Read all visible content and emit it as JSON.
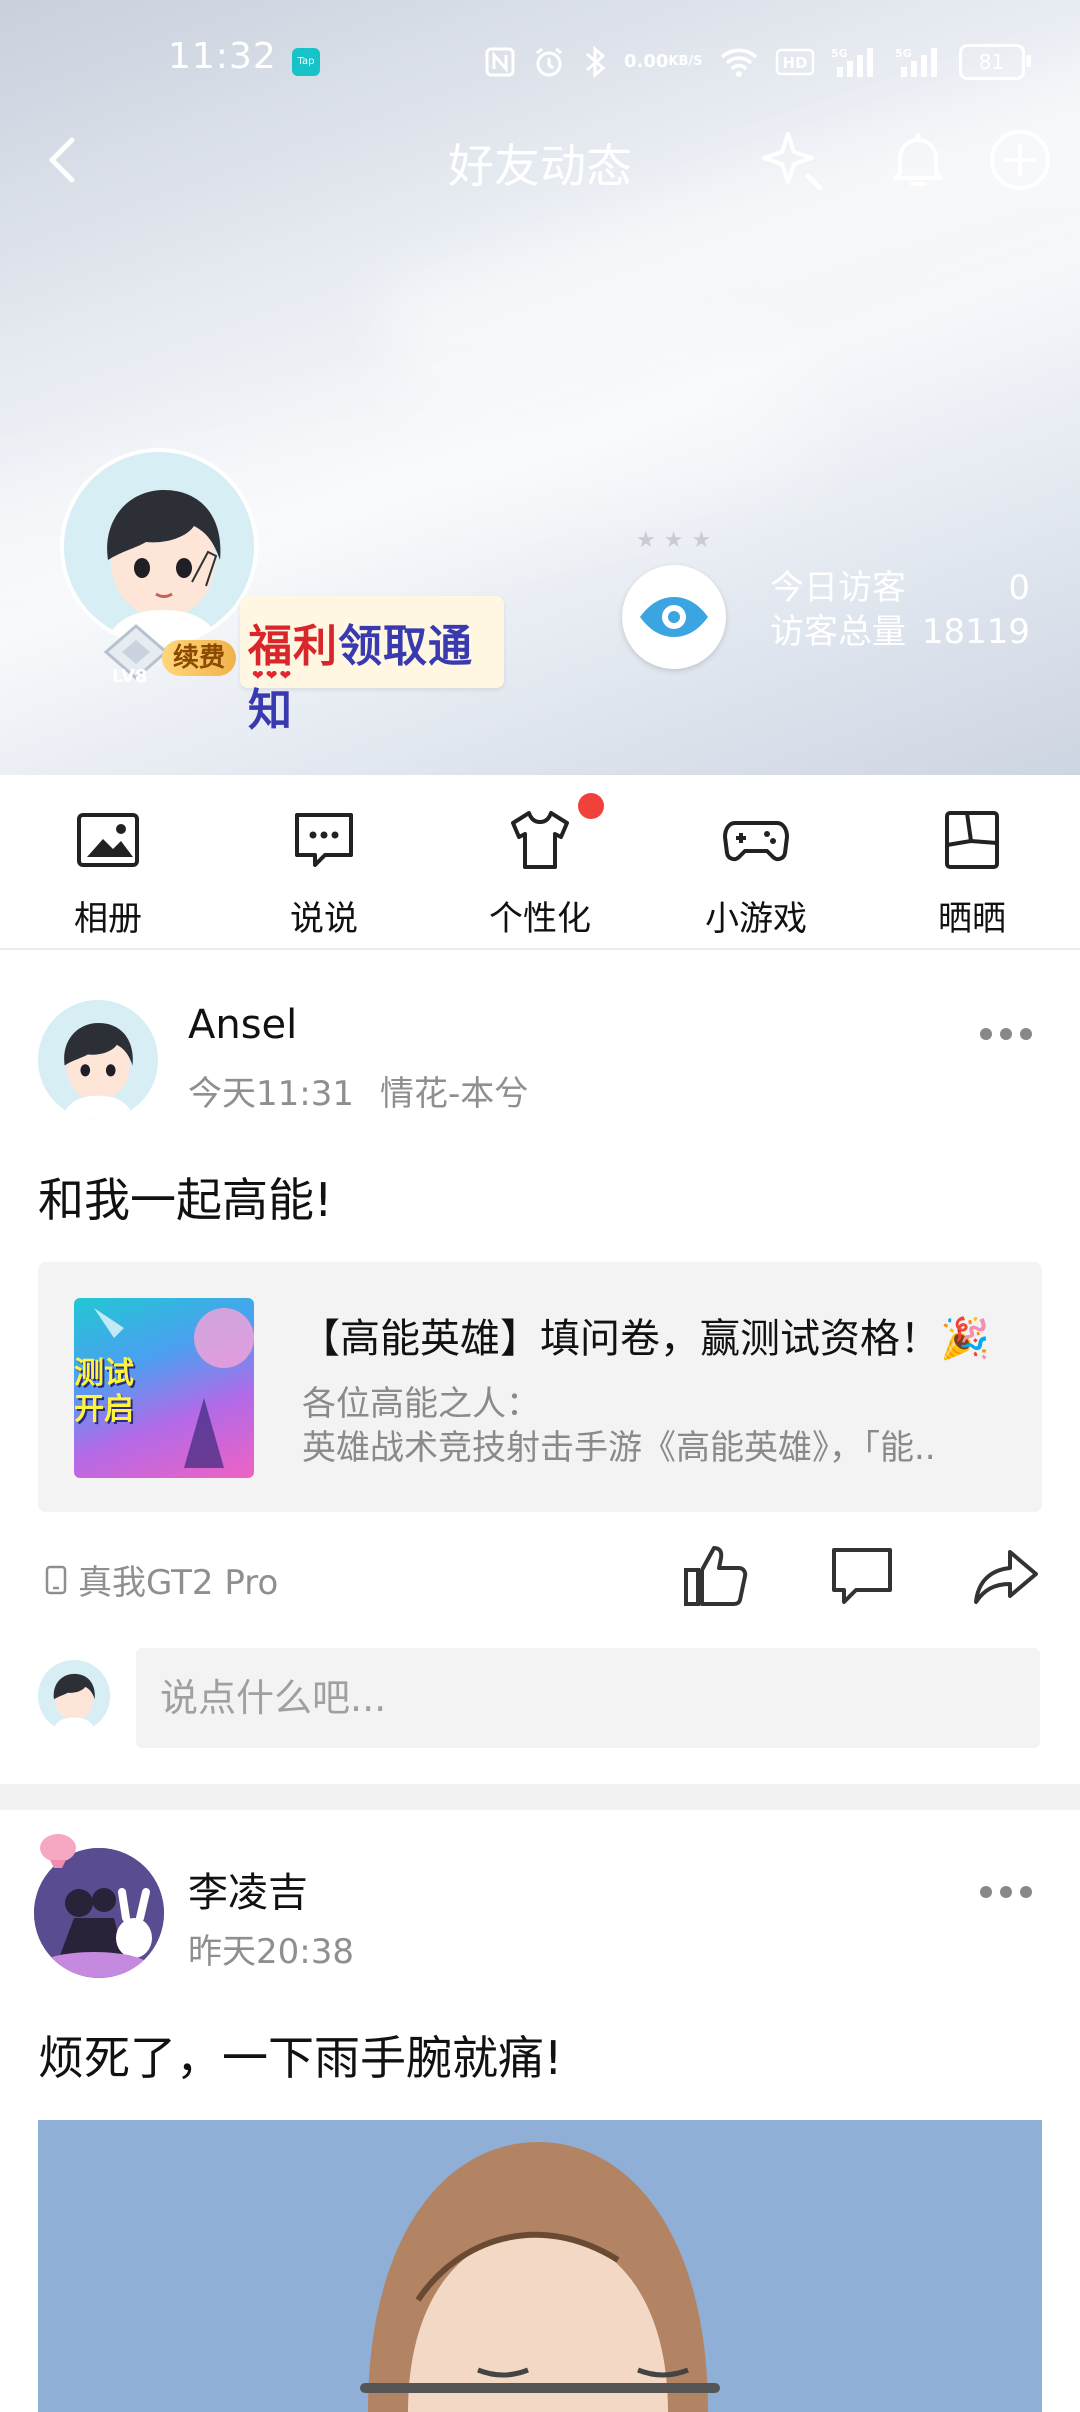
{
  "status_bar": {
    "time": "11:32",
    "tap_badge": "Tap",
    "net_speed_value": "0.00",
    "net_speed_unit": "KB/S",
    "battery": "81",
    "icons": [
      "nfc-icon",
      "alarm-icon",
      "bluetooth-icon",
      "wifi-icon",
      "hd-icon",
      "signal-5g-icon",
      "signal-5g-icon"
    ]
  },
  "nav": {
    "title": "好友动态",
    "icons": [
      "back-icon",
      "magic-wand-icon",
      "bell-icon",
      "plus-circle-icon"
    ]
  },
  "profile": {
    "level": "LV8",
    "renew_label": "续费",
    "welfare_part1": "福利",
    "welfare_part2": "领取通知",
    "visitors_today_label": "今日访客",
    "visitors_today_value": "0",
    "visitors_total_label": "访客总量",
    "visitors_total_value": "18119"
  },
  "quick_actions": [
    {
      "label": "相册",
      "icon": "album-icon"
    },
    {
      "label": "说说",
      "icon": "chat-icon"
    },
    {
      "label": "个性化",
      "icon": "shirt-icon"
    },
    {
      "label": "小游戏",
      "icon": "gamepad-icon"
    },
    {
      "label": "晒晒",
      "icon": "collage-icon"
    }
  ],
  "posts": [
    {
      "name": "Ansel",
      "time": "今天11:31",
      "tag": "情花-本兮",
      "text": "和我一起高能!",
      "share": {
        "title": "【高能英雄】填问卷，赢测试资格！🎉",
        "desc_line1": "各位高能之人：",
        "desc_line2": "英雄战术竞技射击手游《高能英雄》，「能..",
        "thumb_text_line1": "测试",
        "thumb_text_line2": "开启"
      },
      "device": "真我GT2 Pro",
      "comment_placeholder": "说点什么吧..."
    },
    {
      "name": "李凌吉",
      "time": "昨天20:38",
      "text": "烦死了，一下雨手腕就痛!"
    }
  ],
  "colors": {
    "accent_red": "#f0413b",
    "eye_blue": "#3aa5e0",
    "welfare_red": "#d8262b",
    "welfare_blue": "#3a3ab0"
  }
}
